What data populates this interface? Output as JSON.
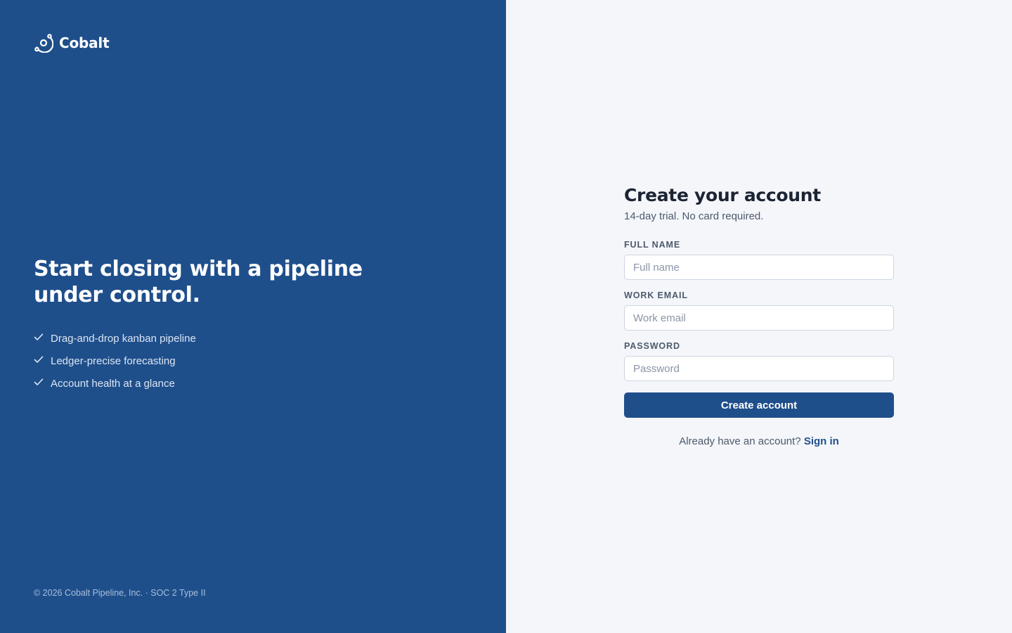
{
  "brand": {
    "name": "Cobalt",
    "logo_icon": "orbit-logo-icon"
  },
  "hero": {
    "title": "Start closing with a pipeline under control.",
    "features": [
      {
        "icon": "check-icon",
        "label": "Drag-and-drop kanban pipeline"
      },
      {
        "icon": "check-icon",
        "label": "Ledger-precise forecasting"
      },
      {
        "icon": "check-icon",
        "label": "Account health at a glance"
      }
    ]
  },
  "footer": {
    "text": "© 2026 Cobalt Pipeline, Inc. · SOC 2 Type II"
  },
  "form": {
    "title": "Create your account",
    "subtitle": "14-day trial. No card required.",
    "fields": [
      {
        "label": "FULL NAME",
        "placeholder": "Full name",
        "value": ""
      },
      {
        "label": "WORK EMAIL",
        "placeholder": "Work email",
        "value": ""
      },
      {
        "label": "PASSWORD",
        "placeholder": "Password",
        "value": ""
      }
    ],
    "submit_label": "Create account",
    "signin_prompt": "Already have an account?",
    "signin_link": "Sign in"
  },
  "colors": {
    "brand_panel": "#1f4f8b",
    "form_background": "#f4f6fa",
    "primary_button": "#1f4f8b",
    "heading_text": "#1b2433"
  }
}
